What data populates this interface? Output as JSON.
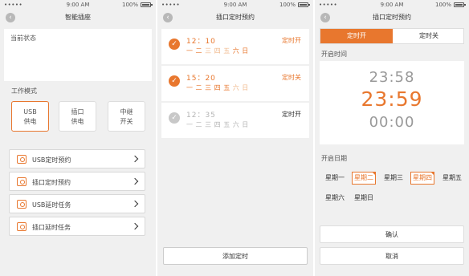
{
  "status_bar": {
    "carrier": "•••••",
    "time": "9:00 AM",
    "battery": "100%"
  },
  "screen1": {
    "title": "智能插座",
    "status_label": "当前状态",
    "mode_label": "工作模式",
    "modes": [
      {
        "line1": "USB",
        "line2": "供电"
      },
      {
        "line1": "插口",
        "line2": "供电"
      },
      {
        "line1": "中继",
        "line2": "开关"
      }
    ],
    "menu": [
      "USB定时预约",
      "插口定时预约",
      "USB延时任务",
      "插口延时任务"
    ]
  },
  "screen2": {
    "title": "插口定时预约",
    "timers": [
      {
        "time": "12：10",
        "days": [
          "一",
          "二",
          "三",
          "四",
          "五",
          "六",
          "日"
        ],
        "action": "定时开"
      },
      {
        "time": "15：20",
        "days": [
          "一",
          "二",
          "三",
          "四",
          "五",
          "六",
          "日"
        ],
        "action": "定时关"
      },
      {
        "time": "12：35",
        "days": [
          "一",
          "二",
          "三",
          "四",
          "五",
          "六",
          "日"
        ],
        "action": "定时开"
      }
    ],
    "add_label": "添加定时"
  },
  "screen3": {
    "title": "插口定时预约",
    "seg_on": "定时开",
    "seg_off": "定时关",
    "start_time_label": "开启时间",
    "picker": {
      "prev": "23:58",
      "current": "23:59",
      "next": "00:00"
    },
    "start_date_label": "开启日期",
    "days": [
      "星期一",
      "星期二",
      "星期三",
      "星期四",
      "星期五",
      "星期六",
      "星期日"
    ],
    "confirm": "确认",
    "cancel": "取消"
  },
  "colors": {
    "accent": "#e8772e",
    "background": "#f0f0f0"
  }
}
